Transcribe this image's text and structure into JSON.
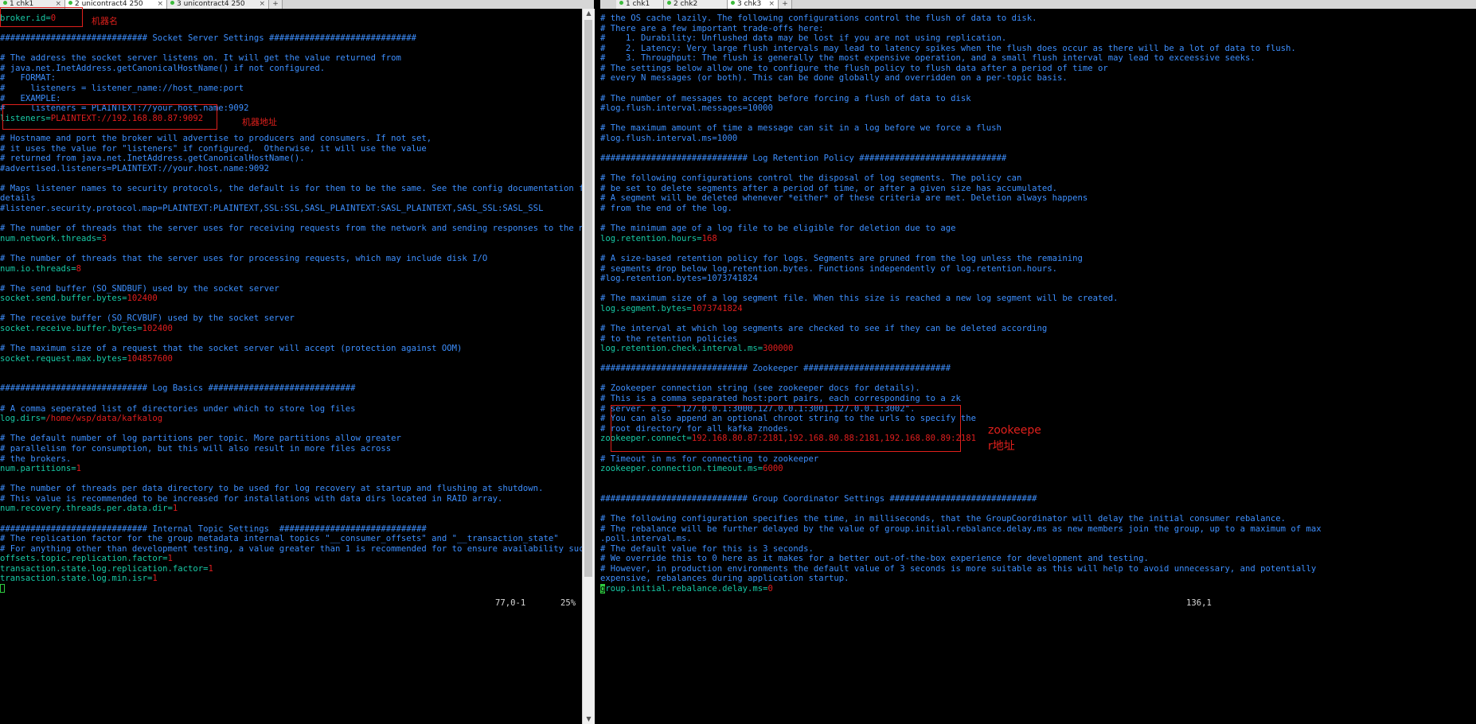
{
  "tabs_left": [
    {
      "label": "1 chk1",
      "active": false
    },
    {
      "label": "2 unicontract4 250",
      "active": true
    },
    {
      "label": "3 unicontract4 250",
      "active": false
    }
  ],
  "tabs_right": [
    {
      "label": "1 chk1",
      "active": false
    },
    {
      "label": "2 chk2",
      "active": false
    },
    {
      "label": "3 chk3",
      "active": true
    }
  ],
  "tab_add_label": "+",
  "left_pane": {
    "status_position": "77,0-1",
    "status_percent": "25%",
    "lines": [
      [
        {
          "t": "broker.id=",
          "c": "k"
        },
        {
          "t": "0",
          "c": "v"
        }
      ],
      [],
      [
        {
          "t": "############################# Socket Server Settings #############################",
          "c": "c"
        }
      ],
      [],
      [
        {
          "t": "# The address the socket server listens on. It will get the value returned from",
          "c": "c"
        }
      ],
      [
        {
          "t": "# java.net.InetAddress.getCanonicalHostName() if not configured.",
          "c": "c"
        }
      ],
      [
        {
          "t": "#   FORMAT:",
          "c": "c"
        }
      ],
      [
        {
          "t": "#     listeners = listener_name://host_name:port",
          "c": "c"
        }
      ],
      [
        {
          "t": "#   EXAMPLE:",
          "c": "c"
        }
      ],
      [
        {
          "t": "#     listeners = PLAINTEXT://your.host.name:9092",
          "c": "c"
        }
      ],
      [
        {
          "t": "listeners=",
          "c": "k"
        },
        {
          "t": "PLAINTEXT://192.168.80.87:9092",
          "c": "v"
        }
      ],
      [],
      [
        {
          "t": "# Hostname and port the broker will advertise to producers and consumers. If not set,",
          "c": "c"
        }
      ],
      [
        {
          "t": "# it uses the value for \"listeners\" if configured.  Otherwise, it will use the value",
          "c": "c"
        }
      ],
      [
        {
          "t": "# returned from java.net.InetAddress.getCanonicalHostName().",
          "c": "c"
        }
      ],
      [
        {
          "t": "#advertised.listeners=PLAINTEXT://your.host.name:9092",
          "c": "c"
        }
      ],
      [],
      [
        {
          "t": "# Maps listener names to security protocols, the default is for them to be the same. See the config documentation for more",
          "c": "c"
        }
      ],
      [
        {
          "t": "details",
          "c": "c"
        }
      ],
      [
        {
          "t": "#listener.security.protocol.map=PLAINTEXT:PLAINTEXT,SSL:SSL,SASL_PLAINTEXT:SASL_PLAINTEXT,SASL_SSL:SASL_SSL",
          "c": "c"
        }
      ],
      [],
      [
        {
          "t": "# The number of threads that the server uses for receiving requests from the network and sending responses to the network",
          "c": "c"
        }
      ],
      [
        {
          "t": "num.network.threads=",
          "c": "k"
        },
        {
          "t": "3",
          "c": "v"
        }
      ],
      [],
      [
        {
          "t": "# The number of threads that the server uses for processing requests, which may include disk I/O",
          "c": "c"
        }
      ],
      [
        {
          "t": "num.io.threads=",
          "c": "k"
        },
        {
          "t": "8",
          "c": "v"
        }
      ],
      [],
      [
        {
          "t": "# The send buffer (SO_SNDBUF) used by the socket server",
          "c": "c"
        }
      ],
      [
        {
          "t": "socket.send.buffer.bytes=",
          "c": "k"
        },
        {
          "t": "102400",
          "c": "v"
        }
      ],
      [],
      [
        {
          "t": "# The receive buffer (SO_RCVBUF) used by the socket server",
          "c": "c"
        }
      ],
      [
        {
          "t": "socket.receive.buffer.bytes=",
          "c": "k"
        },
        {
          "t": "102400",
          "c": "v"
        }
      ],
      [],
      [
        {
          "t": "# The maximum size of a request that the socket server will accept (protection against OOM)",
          "c": "c"
        }
      ],
      [
        {
          "t": "socket.request.max.bytes=",
          "c": "k"
        },
        {
          "t": "104857600",
          "c": "v"
        }
      ],
      [],
      [],
      [
        {
          "t": "############################# Log Basics #############################",
          "c": "c"
        }
      ],
      [],
      [
        {
          "t": "# A comma seperated list of directories under which to store log files",
          "c": "c"
        }
      ],
      [
        {
          "t": "log.dirs=",
          "c": "k"
        },
        {
          "t": "/home/wsp/data/kafkalog",
          "c": "v"
        }
      ],
      [],
      [
        {
          "t": "# The default number of log partitions per topic. More partitions allow greater",
          "c": "c"
        }
      ],
      [
        {
          "t": "# parallelism for consumption, but this will also result in more files across",
          "c": "c"
        }
      ],
      [
        {
          "t": "# the brokers.",
          "c": "c"
        }
      ],
      [
        {
          "t": "num.partitions=",
          "c": "k"
        },
        {
          "t": "1",
          "c": "v"
        }
      ],
      [],
      [
        {
          "t": "# The number of threads per data directory to be used for log recovery at startup and flushing at shutdown.",
          "c": "c"
        }
      ],
      [
        {
          "t": "# This value is recommended to be increased for installations with data dirs located in RAID array.",
          "c": "c"
        }
      ],
      [
        {
          "t": "num.recovery.threads.per.data.dir=",
          "c": "k"
        },
        {
          "t": "1",
          "c": "v"
        }
      ],
      [],
      [
        {
          "t": "############################# Internal Topic Settings  #############################",
          "c": "c"
        }
      ],
      [
        {
          "t": "# The replication factor for the group metadata internal topics \"__consumer_offsets\" and \"__transaction_state\"",
          "c": "c"
        }
      ],
      [
        {
          "t": "# For anything other than development testing, a value greater than 1 is recommended for to ensure availability such as 3.",
          "c": "c"
        }
      ],
      [
        {
          "t": "offsets.topic.replication.factor=",
          "c": "k"
        },
        {
          "t": "1",
          "c": "v"
        }
      ],
      [
        {
          "t": "transaction.state.log.replication.factor=",
          "c": "k"
        },
        {
          "t": "1",
          "c": "v"
        }
      ],
      [
        {
          "t": "transaction.state.log.min.isr=",
          "c": "k"
        },
        {
          "t": "1",
          "c": "v"
        }
      ],
      [
        {
          "t": "",
          "cursor": "box"
        }
      ]
    ]
  },
  "right_pane": {
    "status_position": "136,1",
    "lines": [
      [
        {
          "t": "# the OS cache lazily. The following configurations control the flush of data to disk.",
          "c": "c"
        }
      ],
      [
        {
          "t": "# There are a few important trade-offs here:",
          "c": "c"
        }
      ],
      [
        {
          "t": "#    1. Durability: Unflushed data may be lost if you are not using replication.",
          "c": "c"
        }
      ],
      [
        {
          "t": "#    2. Latency: Very large flush intervals may lead to latency spikes when the flush does occur as there will be a lot of data to flush.",
          "c": "c"
        }
      ],
      [
        {
          "t": "#    3. Throughput: The flush is generally the most expensive operation, and a small flush interval may lead to exceessive seeks.",
          "c": "c"
        }
      ],
      [
        {
          "t": "# The settings below allow one to configure the flush policy to flush data after a period of time or",
          "c": "c"
        }
      ],
      [
        {
          "t": "# every N messages (or both). This can be done globally and overridden on a per-topic basis.",
          "c": "c"
        }
      ],
      [],
      [
        {
          "t": "# The number of messages to accept before forcing a flush of data to disk",
          "c": "c"
        }
      ],
      [
        {
          "t": "#log.flush.interval.messages=10000",
          "c": "c"
        }
      ],
      [],
      [
        {
          "t": "# The maximum amount of time a message can sit in a log before we force a flush",
          "c": "c"
        }
      ],
      [
        {
          "t": "#log.flush.interval.ms=1000",
          "c": "c"
        }
      ],
      [],
      [
        {
          "t": "############################# Log Retention Policy #############################",
          "c": "c"
        }
      ],
      [],
      [
        {
          "t": "# The following configurations control the disposal of log segments. The policy can",
          "c": "c"
        }
      ],
      [
        {
          "t": "# be set to delete segments after a period of time, or after a given size has accumulated.",
          "c": "c"
        }
      ],
      [
        {
          "t": "# A segment will be deleted whenever *either* of these criteria are met. Deletion always happens",
          "c": "c"
        }
      ],
      [
        {
          "t": "# from the end of the log.",
          "c": "c"
        }
      ],
      [],
      [
        {
          "t": "# The minimum age of a log file to be eligible for deletion due to age",
          "c": "c"
        }
      ],
      [
        {
          "t": "log.retention.hours=",
          "c": "k"
        },
        {
          "t": "168",
          "c": "v"
        }
      ],
      [],
      [
        {
          "t": "# A size-based retention policy for logs. Segments are pruned from the log unless the remaining",
          "c": "c"
        }
      ],
      [
        {
          "t": "# segments drop below log.retention.bytes. Functions independently of log.retention.hours.",
          "c": "c"
        }
      ],
      [
        {
          "t": "#log.retention.bytes=1073741824",
          "c": "c"
        }
      ],
      [],
      [
        {
          "t": "# The maximum size of a log segment file. When this size is reached a new log segment will be created.",
          "c": "c"
        }
      ],
      [
        {
          "t": "log.segment.bytes=",
          "c": "k"
        },
        {
          "t": "1073741824",
          "c": "v"
        }
      ],
      [],
      [
        {
          "t": "# The interval at which log segments are checked to see if they can be deleted according",
          "c": "c"
        }
      ],
      [
        {
          "t": "# to the retention policies",
          "c": "c"
        }
      ],
      [
        {
          "t": "log.retention.check.interval.ms=",
          "c": "k"
        },
        {
          "t": "300000",
          "c": "v"
        }
      ],
      [],
      [
        {
          "t": "############################# Zookeeper #############################",
          "c": "c"
        }
      ],
      [],
      [
        {
          "t": "# Zookeeper connection string (see zookeeper docs for details).",
          "c": "c"
        }
      ],
      [
        {
          "t": "# This is a comma separated host:port pairs, each corresponding to a zk",
          "c": "c"
        }
      ],
      [
        {
          "t": "# server. e.g. \"127.0.0.1:3000,127.0.0.1:3001,127.0.0.1:3002\".",
          "c": "c"
        }
      ],
      [
        {
          "t": "# You can also append an optional chroot string to the urls to specify the",
          "c": "c"
        }
      ],
      [
        {
          "t": "# root directory for all kafka znodes.",
          "c": "c"
        }
      ],
      [
        {
          "t": "zookeeper.connect=",
          "c": "k"
        },
        {
          "t": "192.168.80.87:2181,192.168.80.88:2181,192.168.80.89:2181",
          "c": "v"
        }
      ],
      [],
      [
        {
          "t": "# Timeout in ms for connecting to zookeeper",
          "c": "c"
        }
      ],
      [
        {
          "t": "zookeeper.connection.timeout.ms=",
          "c": "k"
        },
        {
          "t": "6000",
          "c": "v"
        }
      ],
      [],
      [],
      [
        {
          "t": "############################# Group Coordinator Settings #############################",
          "c": "c"
        }
      ],
      [],
      [
        {
          "t": "# The following configuration specifies the time, in milliseconds, that the GroupCoordinator will delay the initial consumer rebalance.",
          "c": "c"
        }
      ],
      [
        {
          "t": "# The rebalance will be further delayed by the value of group.initial.rebalance.delay.ms as new members join the group, up to a maximum of max",
          "c": "c"
        }
      ],
      [
        {
          "t": ".poll.interval.ms.",
          "c": "c"
        }
      ],
      [
        {
          "t": "# The default value for this is 3 seconds.",
          "c": "c"
        }
      ],
      [
        {
          "t": "# We override this to 0 here as it makes for a better out-of-the-box experience for development and testing.",
          "c": "c"
        }
      ],
      [
        {
          "t": "# However, in production environments the default value of 3 seconds is more suitable as this will help to avoid unnecessary, and potentially",
          "c": "c"
        }
      ],
      [
        {
          "t": "expensive, rebalances during application startup.",
          "c": "c"
        }
      ],
      [
        {
          "t": "g",
          "cursor": "block"
        },
        {
          "t": "roup.initial.rebalance.delay.ms=",
          "c": "k"
        },
        {
          "t": "0",
          "c": "v"
        }
      ]
    ]
  },
  "annotations": {
    "broker_label": "机器名",
    "listener_label": "机器地址",
    "zookeeper_label_line1": "zookeepe",
    "zookeeper_label_line2": "r地址"
  },
  "colors": {
    "comment": "#3d8fff",
    "key": "#18c9a6",
    "value": "#e01e1e",
    "annotation": "#e0201c",
    "cursor": "#2ecc40"
  }
}
